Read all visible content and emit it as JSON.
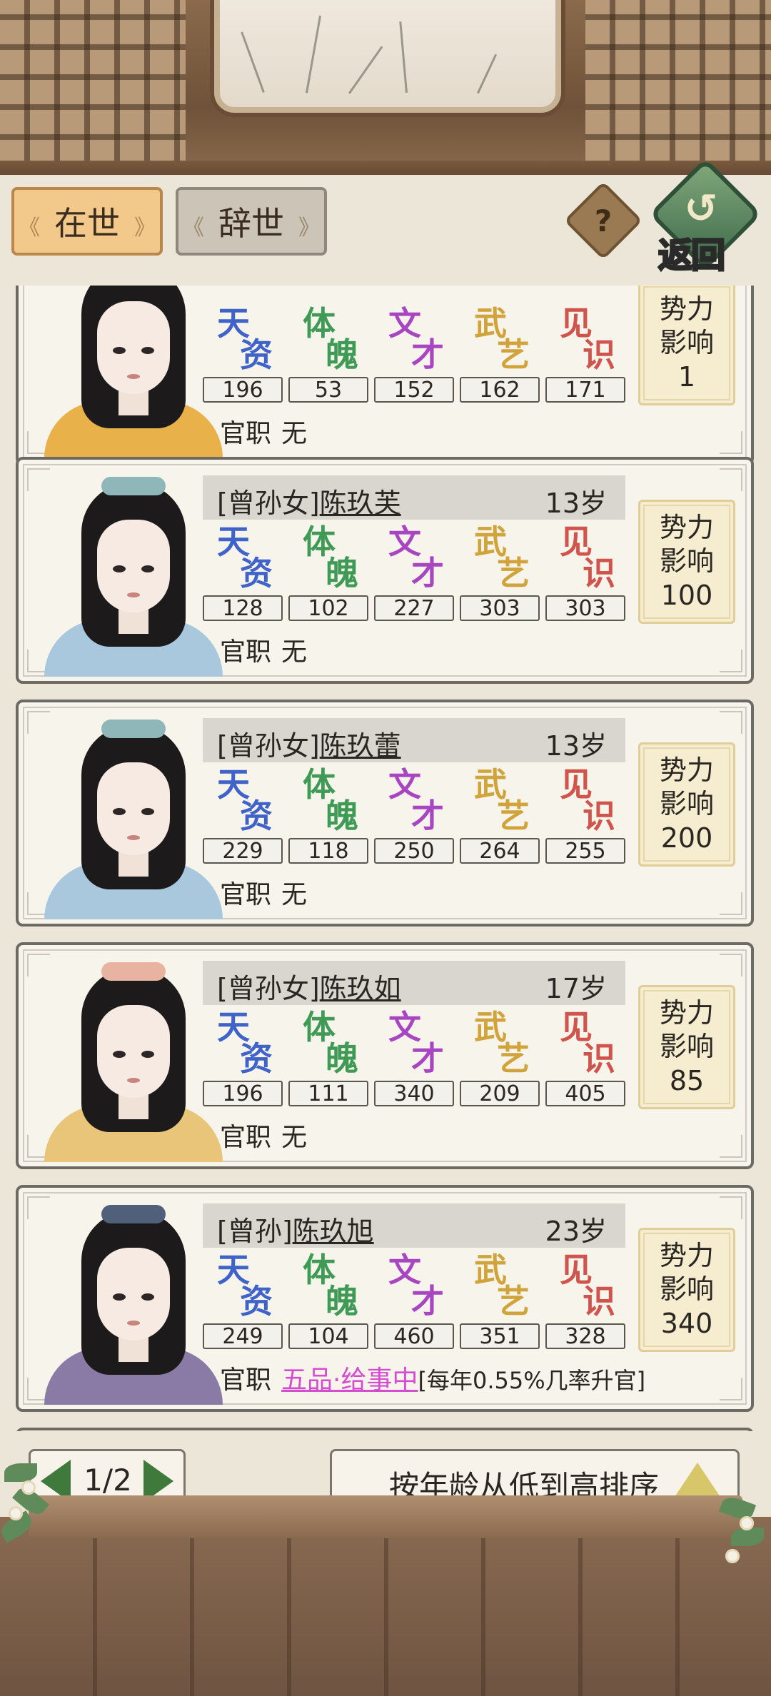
{
  "tabs": {
    "alive": "在世",
    "deceased": "辞世"
  },
  "help_glyph": "?",
  "back": {
    "label": "返回",
    "glyph": "↺"
  },
  "stat_labels": [
    {
      "c1": "天",
      "c2": "资",
      "color": "#3f63c8"
    },
    {
      "c1": "体",
      "c2": "魄",
      "color": "#3e9a55"
    },
    {
      "c1": "文",
      "c2": "才",
      "color": "#a846c2"
    },
    {
      "c1": "武",
      "c2": "艺",
      "color": "#d0a43b"
    },
    {
      "c1": "见",
      "c2": "识",
      "color": "#d0534c"
    }
  ],
  "influence_label": [
    "势力",
    "影响"
  ],
  "office_label": "官职",
  "members": [
    {
      "relation": "",
      "name": "",
      "age": "",
      "stats": [
        "196",
        "53",
        "152",
        "162",
        "171"
      ],
      "influence": "1",
      "office": "无",
      "office_note": "",
      "robe_color": "#e8b14a",
      "ornament_color": "#1c1a1a"
    },
    {
      "relation": "[曾孙女]",
      "name": "陈玖芙",
      "age": "13岁",
      "stats": [
        "128",
        "102",
        "227",
        "303",
        "303"
      ],
      "influence": "100",
      "office": "无",
      "office_note": "",
      "robe_color": "#a9c7dd",
      "ornament_color": "#8fb6b8"
    },
    {
      "relation": "[曾孙女]",
      "name": "陈玖蕾",
      "age": "13岁",
      "stats": [
        "229",
        "118",
        "250",
        "264",
        "255"
      ],
      "influence": "200",
      "office": "无",
      "office_note": "",
      "robe_color": "#a9c7dd",
      "ornament_color": "#8fb6b8"
    },
    {
      "relation": "[曾孙女]",
      "name": "陈玖如",
      "age": "17岁",
      "stats": [
        "196",
        "111",
        "340",
        "209",
        "405"
      ],
      "influence": "85",
      "office": "无",
      "office_note": "",
      "robe_color": "#e9c57a",
      "ornament_color": "#e8b3a0"
    },
    {
      "relation": "[曾孙]",
      "name": "陈玖旭",
      "age": "23岁",
      "stats": [
        "249",
        "104",
        "460",
        "351",
        "328"
      ],
      "influence": "340",
      "office": "五品·给事中",
      "office_note": "[每年0.55%几率升官]",
      "robe_color": "#8a7aa6",
      "ornament_color": "#50607a"
    }
  ],
  "pager": {
    "current": "1/2"
  },
  "sort": {
    "label": "按年龄从低到高排序"
  }
}
